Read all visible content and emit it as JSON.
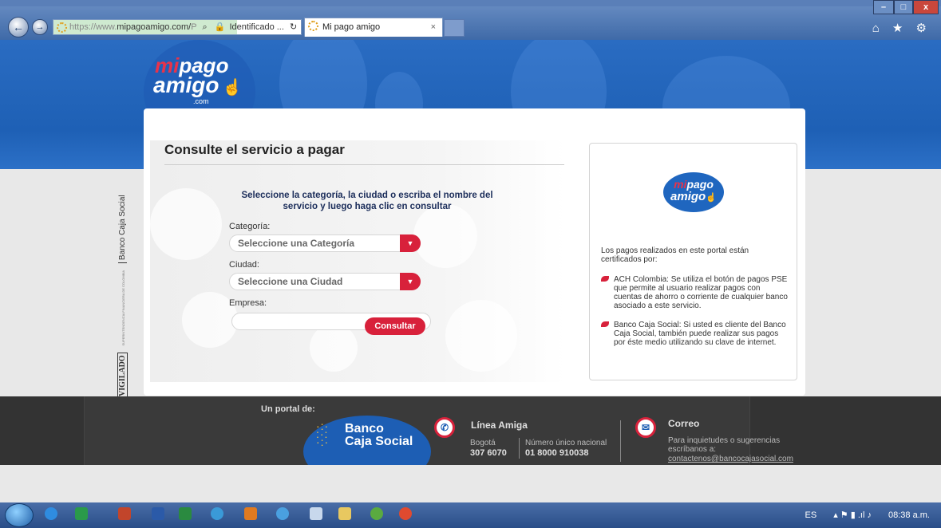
{
  "browser": {
    "url_prefix": "https://www.",
    "url_domain": "mipagoamigo.com/",
    "url_suffix": "P",
    "security_label": "Identificado ...",
    "tab_title": "Mi pago amigo",
    "tab_close": "×",
    "back_icon": "←",
    "forward_icon": "→",
    "toolbar_icons": "⌂ ★ ⚙"
  },
  "window_controls": {
    "minimize": "–",
    "maximize": "□",
    "close": "x"
  },
  "logo": {
    "mi": "mi",
    "pago": "pago",
    "amigo": "amigo",
    "com": ".com"
  },
  "vigilado": {
    "bank": "Banco Caja Social",
    "label": "VIGILADO",
    "super": "SUPERINTENDENCIA FINANCIERA DE COLOMBIA"
  },
  "form": {
    "title": "Consulte el servicio a pagar",
    "instructions": "Seleccione la categoría, la ciudad o escriba el nombre del servicio y luego haga clic en consultar",
    "category_label": "Categoría:",
    "category_value": "Seleccione una Categoría",
    "city_label": "Ciudad:",
    "city_value": "Seleccione una Ciudad",
    "company_label": "Empresa:",
    "company_value": "",
    "submit": "Consultar",
    "dropdown_arrow": "▼"
  },
  "side": {
    "intro": "Los pagos realizados en este portal están certificados por:",
    "bullets": [
      "ACH Colombia: Se utiliza el botón de pagos PSE que permite al usuario realizar pagos con cuentas de ahorro o corriente de cualquier banco asociado a este servicio.",
      "Banco Caja Social: Si usted es cliente del Banco Caja Social, también puede realizar sus pagos por éste medio utilizando su clave de internet."
    ]
  },
  "footer": {
    "portal_label": "Un portal de:",
    "bank_line1": "Banco",
    "bank_line2": "Caja Social",
    "linea_title": "Línea Amiga",
    "city": "Bogotá",
    "city_phone": "307 6070",
    "national_label": "Número único nacional",
    "national_phone": "01 8000 910038",
    "mail_title": "Correo",
    "mail_text": "Para inquietudes o sugerencias escríbanos a:",
    "mail_link": "contactenos@bancocajasocial.com"
  },
  "taskbar": {
    "lang": "ES",
    "time": "08:38 a.m."
  },
  "colors": {
    "accent": "#d8213b",
    "brand_blue": "#1e60b5"
  }
}
